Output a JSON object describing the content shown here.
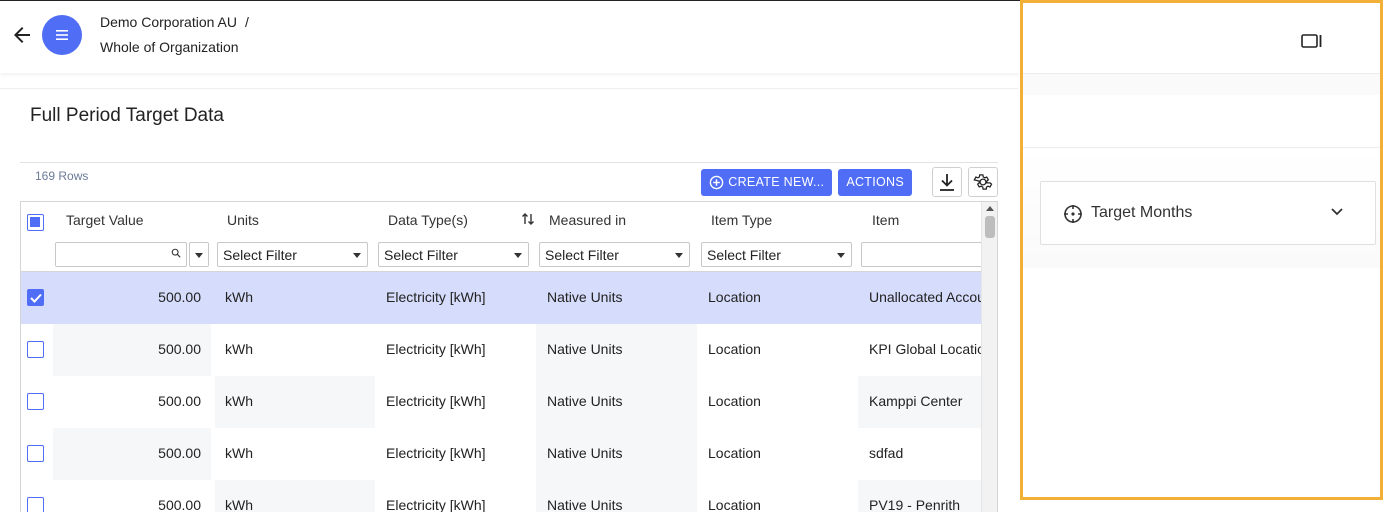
{
  "header": {
    "breadcrumb": [
      "Demo Corporation AU",
      "Whole of Organization"
    ],
    "breadcrumb_separator": "/"
  },
  "page": {
    "title": "Full Period Target Data"
  },
  "grid": {
    "row_count": "169 Rows",
    "toolbar": {
      "create_label": "CREATE NEW...",
      "actions_label": "ACTIONS"
    },
    "columns": [
      "Target Value",
      "Units",
      "Data Type(s)",
      "Measured in",
      "Item Type",
      "Item"
    ],
    "filter_placeholder": "Select Filter",
    "rows": [
      {
        "selected": true,
        "value": "500.00",
        "units": "kWh",
        "data_type": "Electricity [kWh]",
        "measured_in": "Native Units",
        "item_type": "Location",
        "item": "Unallocated Account"
      },
      {
        "selected": false,
        "value": "500.00",
        "units": "kWh",
        "data_type": "Electricity [kWh]",
        "measured_in": "Native Units",
        "item_type": "Location",
        "item": "KPI Global Location"
      },
      {
        "selected": false,
        "value": "500.00",
        "units": "kWh",
        "data_type": "Electricity [kWh]",
        "measured_in": "Native Units",
        "item_type": "Location",
        "item": "Kamppi Center"
      },
      {
        "selected": false,
        "value": "500.00",
        "units": "kWh",
        "data_type": "Electricity [kWh]",
        "measured_in": "Native Units",
        "item_type": "Location",
        "item": "sdfad"
      },
      {
        "selected": false,
        "value": "500.00",
        "units": "kWh",
        "data_type": "Electricity [kWh]",
        "measured_in": "Native Units",
        "item_type": "Location",
        "item": "PV19 - Penrith"
      }
    ]
  },
  "panel": {
    "accordion_label": "Target Months"
  },
  "colors": {
    "accent": "#4f6df5",
    "panel_border": "#f2b136",
    "selected_row": "#d6dcfb"
  }
}
